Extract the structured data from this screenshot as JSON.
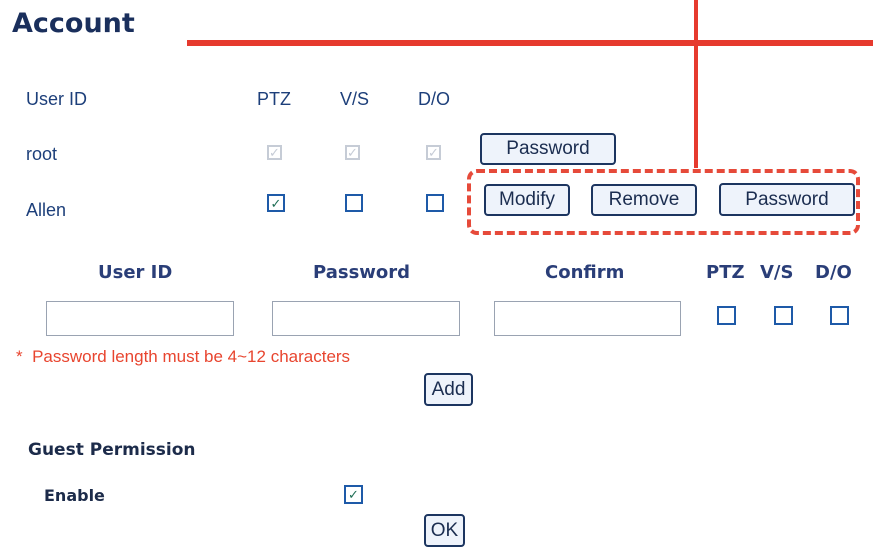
{
  "page": {
    "title": "Account"
  },
  "users_table": {
    "headers": {
      "user_id": "User ID",
      "ptz": "PTZ",
      "vs": "V/S",
      "do": "D/O"
    },
    "rows": [
      {
        "user_id": "root",
        "ptz": true,
        "vs": true,
        "do": true,
        "ptz_mark": "✓",
        "vs_mark": "✓",
        "do_mark": "✓",
        "disabled": true,
        "password_label": "Password"
      },
      {
        "user_id": "Allen",
        "ptz": true,
        "vs": false,
        "do": false,
        "ptz_mark": "✓",
        "vs_mark": "",
        "do_mark": "",
        "modify_label": "Modify",
        "remove_label": "Remove",
        "password_label": "Password"
      }
    ]
  },
  "add_user": {
    "headers": {
      "user_id": "User ID",
      "password": "Password",
      "confirm": "Confirm",
      "ptz": "PTZ",
      "vs": "V/S",
      "do": "D/O"
    },
    "values": {
      "user_id": "",
      "password": "",
      "confirm": ""
    },
    "checks": {
      "ptz": false,
      "vs": false,
      "do": false
    },
    "note_star": "*",
    "note": "Password length must be 4~12 characters",
    "add_label": "Add"
  },
  "guest": {
    "title": "Guest Permission",
    "enable_label": "Enable",
    "enabled": true,
    "enable_mark": "✓",
    "ok_label": "OK"
  },
  "colors": {
    "annotation": "#e63a2e",
    "text": "#1d3f7a",
    "note": "#e8452f"
  }
}
